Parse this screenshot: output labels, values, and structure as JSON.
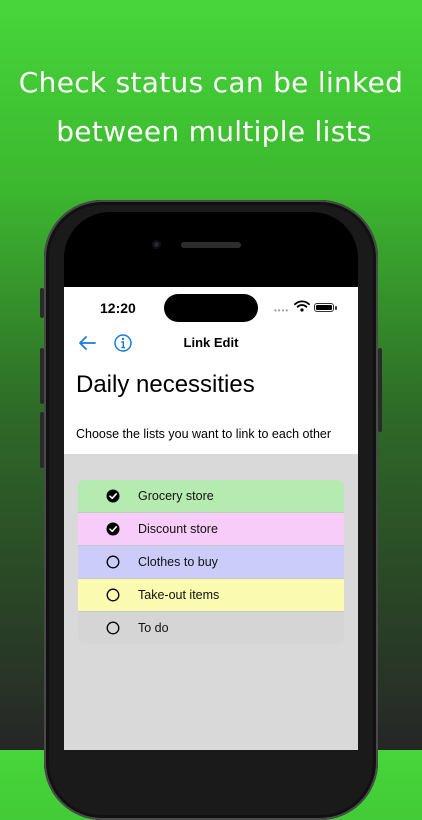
{
  "headline": {
    "line1": "Check status can be linked",
    "line2": "between multiple lists"
  },
  "status_bar": {
    "time": "12:20",
    "signal": "••••"
  },
  "nav": {
    "back_icon": "arrow-left-icon",
    "info_icon": "info-circle-icon",
    "title": "Link Edit"
  },
  "page": {
    "title": "Daily necessities",
    "subtitle": "Choose the lists you want to link to each other"
  },
  "lists": [
    {
      "label": "Grocery store",
      "checked": true,
      "color": "#b5ebb0"
    },
    {
      "label": "Discount store",
      "checked": true,
      "color": "#f8ccf8"
    },
    {
      "label": "Clothes to buy",
      "checked": false,
      "color": "#ccccfa"
    },
    {
      "label": "Take-out items",
      "checked": false,
      "color": "#fafab0"
    },
    {
      "label": "To do",
      "checked": false,
      "color": "#d5d5d5"
    }
  ],
  "colors": {
    "accent": "#1a7be0",
    "background_top": "#46d63a",
    "background_bottom": "#262626"
  }
}
